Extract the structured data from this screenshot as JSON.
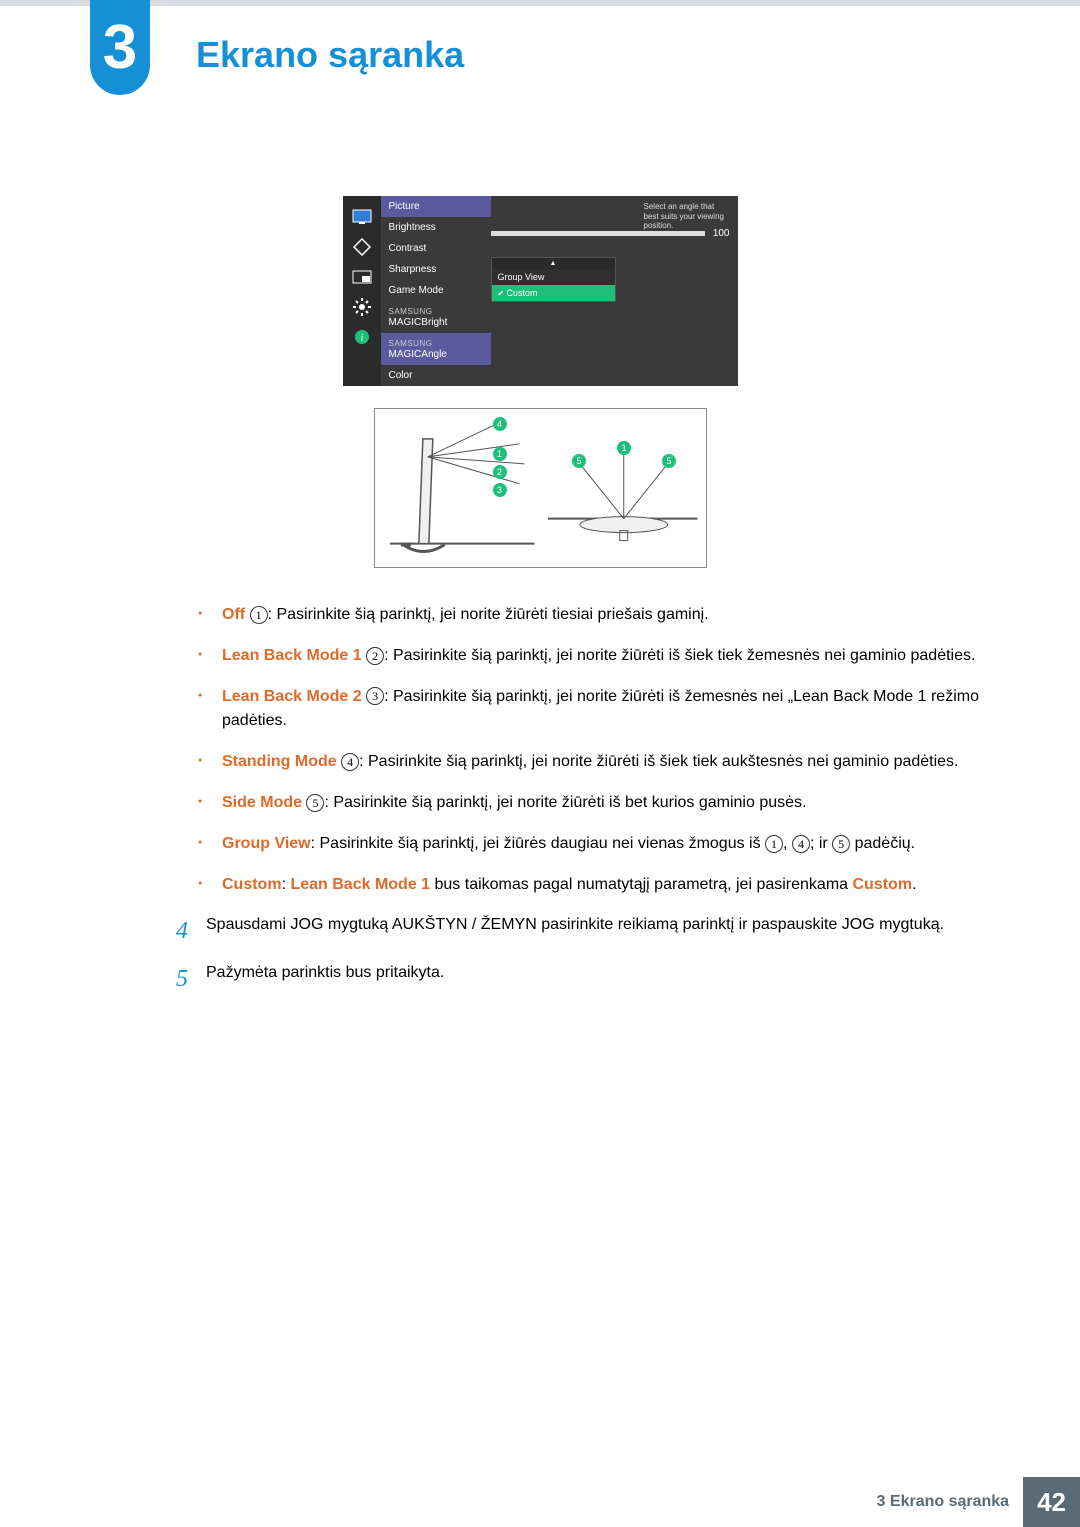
{
  "chapter": {
    "number": "3",
    "title": "Ekrano sąranka"
  },
  "osd": {
    "headerLabel": "Picture",
    "items": {
      "brightness": "Brightness",
      "contrast": "Contrast",
      "sharpness": "Sharpness",
      "gameMode": "Game Mode",
      "magicBrand": "SAMSUNG",
      "magicBright": "MAGICBright",
      "magicAngle": "MAGICAngle",
      "color": "Color"
    },
    "sliderValue": "100",
    "dropdown": {
      "groupView": "Group View",
      "custom": "Custom"
    },
    "hint": "Select an angle that best suits your viewing position."
  },
  "diagram": {
    "m1": "1",
    "m2": "2",
    "m3": "3",
    "m4": "4",
    "m5": "5"
  },
  "bullets": {
    "off": {
      "label": "Off",
      "num": "1",
      "text": ": Pasirinkite šią parinktį, jei norite žiūrėti tiesiai priešais gaminį."
    },
    "lb1": {
      "label": "Lean Back Mode 1",
      "num": "2",
      "text": ": Pasirinkite šią parinktį, jei norite žiūrėti iš šiek tiek žemesnės nei gaminio padėties."
    },
    "lb2": {
      "label": "Lean Back Mode 2",
      "num": "3",
      "text": ": Pasirinkite šią parinktį, jei norite žiūrėti iš žemesnės nei „Lean Back Mode 1 režimo padėties."
    },
    "stand": {
      "label": "Standing Mode",
      "num": "4",
      "text": ": Pasirinkite šią parinktį, jei norite žiūrėti iš šiek tiek aukštesnės nei gaminio padėties."
    },
    "side": {
      "label": "Side Mode",
      "num": "5",
      "text": ": Pasirinkite šią parinktį, jei norite žiūrėti iš bet kurios gaminio pusės."
    },
    "group": {
      "label": "Group View",
      "pre": ": Pasirinkite šią parinktį, jei žiūrės daugiau nei vienas žmogus iš ",
      "n1": "1",
      "sep1": ", ",
      "n2": "4",
      "sep2": "; ir ",
      "n3": "5",
      "post": " padėčių."
    },
    "custom": {
      "label": "Custom",
      "text1": ": ",
      "bold2": "Lean Back Mode 1",
      "text2": " bus taikomas pagal numatytąjį parametrą, jei pasirenkama ",
      "label2": "Custom",
      "text3": "."
    }
  },
  "steps": {
    "s4": {
      "num": "4",
      "text": "Spausdami JOG mygtuką AUKŠTYN / ŽEMYN pasirinkite reikiamą parinktį ir paspauskite JOG mygtuką."
    },
    "s5": {
      "num": "5",
      "text": "Pažymėta parinktis bus pritaikyta."
    }
  },
  "footer": {
    "text": "3 Ekrano sąranka",
    "page": "42"
  }
}
